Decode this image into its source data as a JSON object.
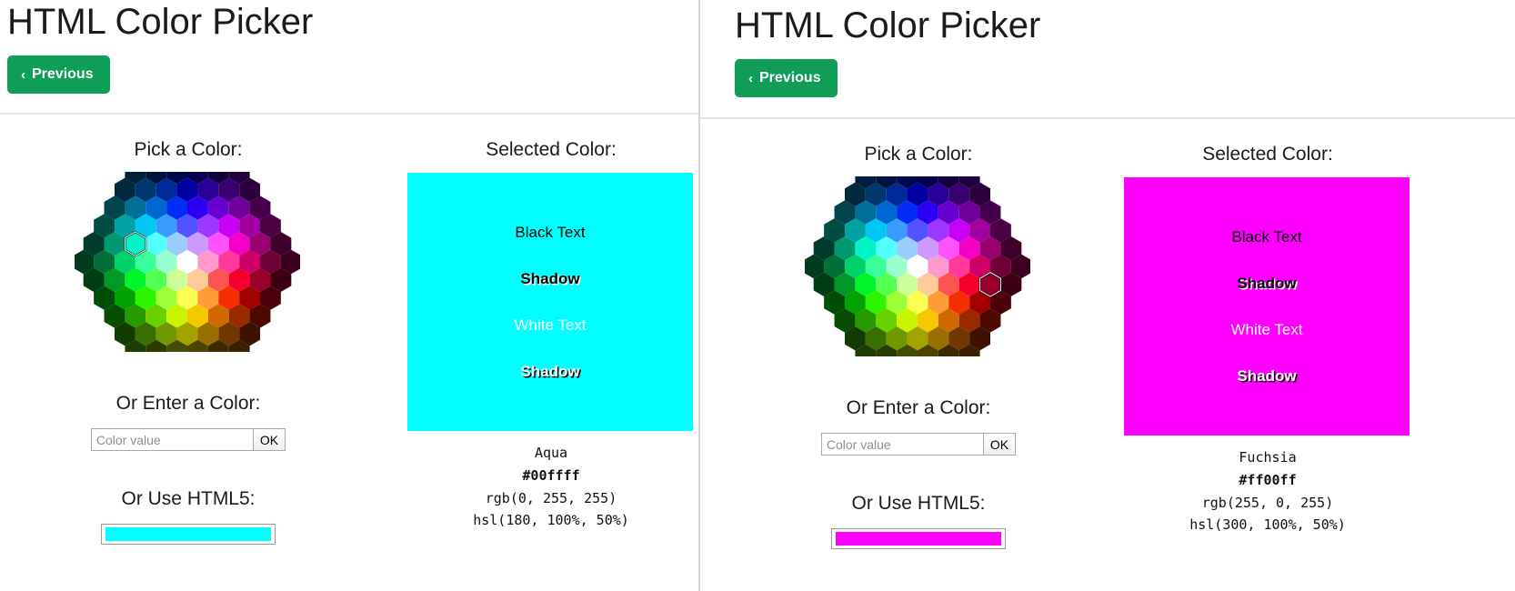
{
  "panels": [
    {
      "header": {
        "title": "HTML Color Picker",
        "previous_label": "Previous",
        "previous_chevron": "‹",
        "button_color": "#0f9d58"
      },
      "picker": {
        "pick_label": "Pick a Color:",
        "enter_label": "Or Enter a Color:",
        "input_value": "",
        "input_placeholder": "Color value",
        "ok_label": "OK",
        "html5_label": "Or Use HTML5:",
        "html5_value": "#00ffff",
        "selected_hex_cell": {
          "col": 3,
          "row": 3
        }
      },
      "preview": {
        "selected_label": "Selected Color:",
        "swatch_color": "#00ffff",
        "lines": [
          "Black Text",
          "Shadow",
          "White Text",
          "Shadow"
        ],
        "name": "Aqua",
        "hex": "#00ffff",
        "rgb": "rgb(0, 255, 255)",
        "hsl": "hsl(180, 100%, 50%)"
      }
    },
    {
      "header": {
        "title": "HTML Color Picker",
        "previous_label": "Previous",
        "previous_chevron": "‹",
        "button_color": "#0f9d58"
      },
      "picker": {
        "pick_label": "Pick a Color:",
        "enter_label": "Or Enter a Color:",
        "input_value": "",
        "input_placeholder": "Color value",
        "ok_label": "OK",
        "html5_label": "Or Use HTML5:",
        "html5_value": "#ff00ff",
        "selected_hex_cell": {
          "col": 8,
          "row": 5
        }
      },
      "preview": {
        "selected_label": "Selected Color:",
        "swatch_color": "#ff00ff",
        "lines": [
          "Black Text",
          "Shadow",
          "White Text",
          "Shadow"
        ],
        "name": "Fuchsia",
        "hex": "#ff00ff",
        "rgb": "rgb(255, 0, 255)",
        "hsl": "hsl(300, 100%, 50%)"
      }
    }
  ]
}
